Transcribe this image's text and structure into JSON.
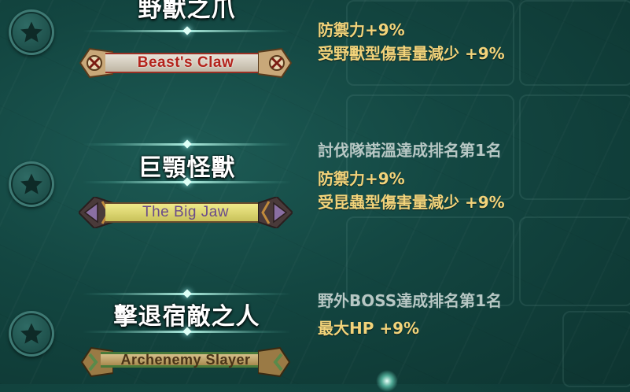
{
  "colors": {
    "effect_text": "#f2d37a",
    "condition_text": "#b7c7c4",
    "background": "#134641"
  },
  "titles": [
    {
      "name": "野獸之爪",
      "banner": "Beast's Claw",
      "banner_style": "red",
      "condition": "",
      "effects": [
        "防禦力+9%",
        "受野獸型傷害量減少 +9%"
      ],
      "icon": "star-icon"
    },
    {
      "name": "巨顎怪獸",
      "banner": "The Big Jaw",
      "banner_style": "purple",
      "condition": "討伐隊諾溫達成排名第1名",
      "effects": [
        "防禦力+9%",
        "受昆蟲型傷害量減少 +9%"
      ],
      "icon": "star-icon"
    },
    {
      "name": "擊退宿敵之人",
      "banner": "Archenemy Slayer",
      "banner_style": "green",
      "condition": "野外BOSS達成排名第1名",
      "effects": [
        "最大HP +9%"
      ],
      "icon": "star-icon"
    }
  ]
}
